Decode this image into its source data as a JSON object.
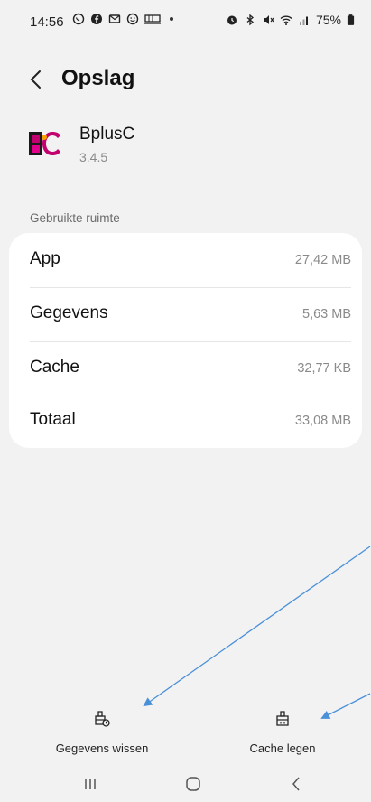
{
  "status_bar": {
    "time": "14:56",
    "battery": "75%"
  },
  "header": {
    "title": "Opslag"
  },
  "app": {
    "name": "BplusC",
    "version": "3.4.5",
    "icon_text": "BC",
    "icon_colors": {
      "primary": "#c2006e",
      "secondary": "#f5a300"
    }
  },
  "storage": {
    "section_label": "Gebruikte ruimte",
    "rows": [
      {
        "label": "App",
        "value": "27,42 MB"
      },
      {
        "label": "Gegevens",
        "value": "5,63 MB"
      },
      {
        "label": "Cache",
        "value": "32,77  KB"
      },
      {
        "label": "Totaal",
        "value": "33,08 MB"
      }
    ]
  },
  "actions": {
    "clear_data": "Gegevens wissen",
    "clear_cache": "Cache legen"
  },
  "colors": {
    "background": "#f2f2f2",
    "card": "#ffffff",
    "annotation_arrow": "#4a90d9"
  }
}
